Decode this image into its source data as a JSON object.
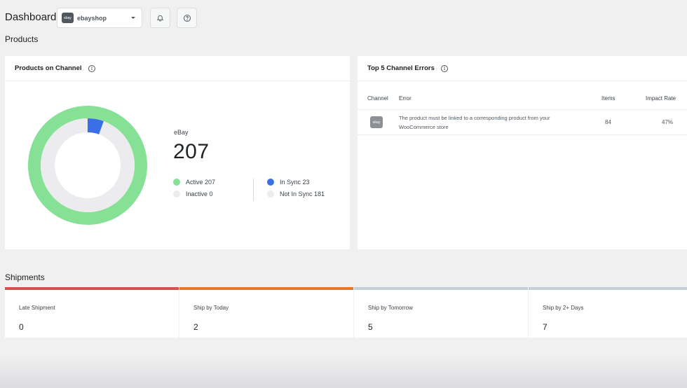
{
  "header": {
    "title": "Dashboard",
    "shop_select": {
      "value": "ebayshop",
      "logo_text": "ebay"
    }
  },
  "products": {
    "section_title": "Products",
    "on_channel": {
      "title": "Products on Channel",
      "channel": "eBay",
      "count": "207",
      "legend": {
        "active": "Active 207",
        "inactive": "Inactive 0",
        "in_sync": "In Sync 23",
        "not_in_sync": "Not In Sync 181"
      },
      "donut": {
        "active": 207,
        "inactive": 0,
        "in_sync": 23,
        "not_in_sync": 181
      },
      "colors": {
        "active": "#86e096",
        "in_sync": "#3a6fe8",
        "not_in_sync": "#ececee"
      }
    },
    "errors": {
      "title": "Top 5 Channel Errors",
      "columns": {
        "channel": "Channel",
        "error": "Error",
        "items": "Items",
        "impact": "Impact Rate"
      },
      "rows": [
        {
          "channel_logo": "ebay",
          "error_line1": "The product must be linked to a corresponding product from your",
          "error_line2": "WooCommerce store",
          "items": "84",
          "impact": "47%"
        }
      ]
    }
  },
  "shipments": {
    "section_title": "Shipments",
    "cards": [
      {
        "label": "Late Shipment",
        "value": "0",
        "color": "#d94f4f"
      },
      {
        "label": "Ship by Today",
        "value": "2",
        "color": "#e6782c"
      },
      {
        "label": "Ship by Tomorrow",
        "value": "5",
        "color": "#c3cfd9"
      },
      {
        "label": "Ship by 2+ Days",
        "value": "7",
        "color": "#c3cfd9"
      }
    ]
  }
}
